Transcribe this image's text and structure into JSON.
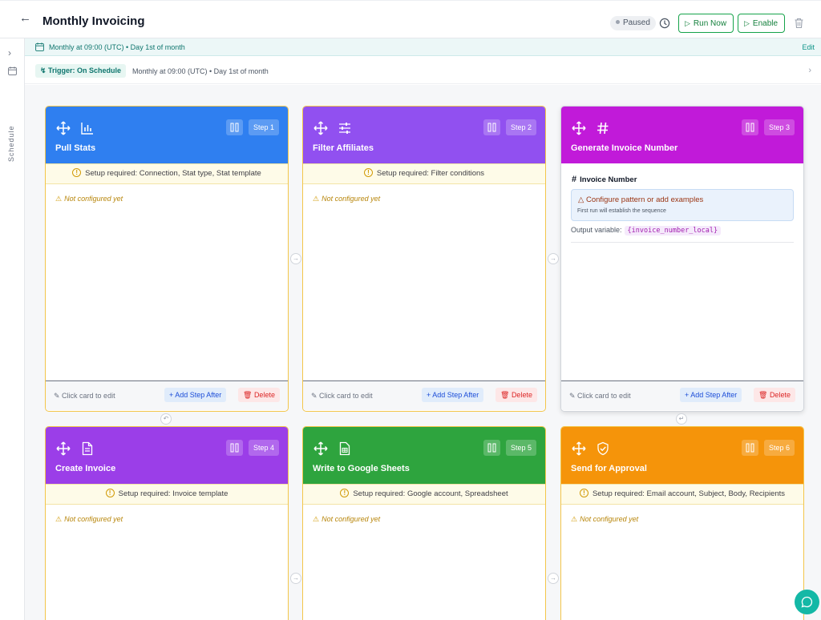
{
  "header": {
    "title": "Monthly Invoicing",
    "status": "Paused",
    "run_now_label": "Run Now",
    "enable_label": "Enable"
  },
  "sidebar": {
    "label": "Schedule"
  },
  "schedule_bar": {
    "text": "Monthly at 09:00 (UTC) • Day 1st of month",
    "edit_label": "Edit"
  },
  "trigger": {
    "label": "Trigger: On Schedule",
    "description": "Monthly at 09:00 (UTC) • Day 1st of month"
  },
  "cards": [
    {
      "title": "Pull Stats",
      "step_label": "Step 1",
      "color": "#2f7ff0",
      "icon": "chart-icon",
      "setup": "Setup required: Connection, Stat type, Stat template",
      "status": "Not configured yet",
      "edit_hint": "Click card to edit",
      "add_label": "+ Add Step After",
      "delete_label": "Delete"
    },
    {
      "title": "Filter Affiliates",
      "step_label": "Step 2",
      "color": "#9150f0",
      "icon": "sliders-icon",
      "setup": "Setup required: Filter conditions",
      "status": "Not configured yet",
      "edit_hint": "Click card to edit",
      "add_label": "+ Add Step After",
      "delete_label": "Delete"
    },
    {
      "title": "Generate Invoice Number",
      "step_label": "Step 3",
      "color": "#c11ad9",
      "icon": "hash-icon",
      "section_title": "Invoice Number",
      "notice": "Configure pattern or add examples",
      "notice_sub": "First run will establish the sequence",
      "output_label": "Output variable:",
      "output_var": "{invoice_number_local}",
      "edit_hint": "Click card to edit",
      "add_label": "+ Add Step After",
      "delete_label": "Delete"
    },
    {
      "title": "Create Invoice",
      "step_label": "Step 4",
      "color": "#9b3ee8",
      "icon": "document-icon",
      "setup": "Setup required: Invoice template",
      "status": "Not configured yet"
    },
    {
      "title": "Write to Google Sheets",
      "step_label": "Step 5",
      "color": "#2ea43e",
      "icon": "spreadsheet-icon",
      "setup": "Setup required: Google account, Spreadsheet",
      "status": "Not configured yet"
    },
    {
      "title": "Send for Approval",
      "step_label": "Step 6",
      "color": "#f5940a",
      "icon": "shield-check-icon",
      "setup": "Setup required: Email account, Subject, Body, Recipients",
      "status": "Not configured yet"
    }
  ],
  "colors": {
    "accent": "#0d9488",
    "setup_border": "#f3c64a"
  }
}
